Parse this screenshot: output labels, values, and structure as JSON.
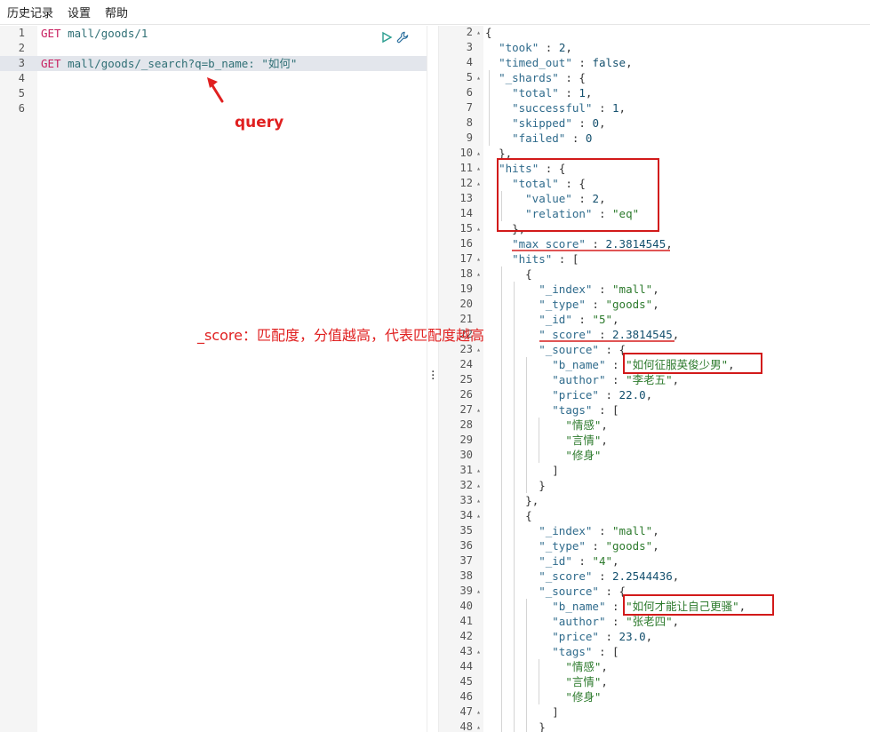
{
  "menu": [
    "历史记录",
    "设置",
    "帮助"
  ],
  "request": {
    "lines": [
      {
        "n": "1",
        "method": "GET",
        "url": " mall/goods/1"
      },
      {
        "n": "2",
        "method": "",
        "url": ""
      },
      {
        "n": "3",
        "method": "GET",
        "url": " mall/goods/_search?q=b_name: \"如何\""
      },
      {
        "n": "4",
        "method": "",
        "url": ""
      },
      {
        "n": "5",
        "method": "",
        "url": ""
      },
      {
        "n": "6",
        "method": "",
        "url": ""
      }
    ],
    "active_line": "3"
  },
  "annotations": {
    "query_label": "query",
    "score_note": "_score：匹配度，分值越高，代表匹配度越高"
  },
  "response": {
    "lines": [
      {
        "n": "2",
        "fold": true,
        "text": "{"
      },
      {
        "n": "3",
        "fold": false,
        "text": "  \"took\" : 2,"
      },
      {
        "n": "4",
        "fold": false,
        "text": "  \"timed_out\" : false,"
      },
      {
        "n": "5",
        "fold": true,
        "text": "  \"_shards\" : {"
      },
      {
        "n": "6",
        "fold": false,
        "text": "    \"total\" : 1,"
      },
      {
        "n": "7",
        "fold": false,
        "text": "    \"successful\" : 1,"
      },
      {
        "n": "8",
        "fold": false,
        "text": "    \"skipped\" : 0,"
      },
      {
        "n": "9",
        "fold": false,
        "text": "    \"failed\" : 0"
      },
      {
        "n": "10",
        "fold": true,
        "text": "  },"
      },
      {
        "n": "11",
        "fold": true,
        "text": "  \"hits\" : {"
      },
      {
        "n": "12",
        "fold": true,
        "text": "    \"total\" : {"
      },
      {
        "n": "13",
        "fold": false,
        "text": "      \"value\" : 2,"
      },
      {
        "n": "14",
        "fold": false,
        "text": "      \"relation\" : \"eq\""
      },
      {
        "n": "15",
        "fold": true,
        "text": "    },"
      },
      {
        "n": "16",
        "fold": false,
        "text": "    \"max_score\" : 2.3814545,"
      },
      {
        "n": "17",
        "fold": true,
        "text": "    \"hits\" : ["
      },
      {
        "n": "18",
        "fold": true,
        "text": "      {"
      },
      {
        "n": "19",
        "fold": false,
        "text": "        \"_index\" : \"mall\","
      },
      {
        "n": "20",
        "fold": false,
        "text": "        \"_type\" : \"goods\","
      },
      {
        "n": "21",
        "fold": false,
        "text": "        \"_id\" : \"5\","
      },
      {
        "n": "22",
        "fold": false,
        "text": "        \"_score\" : 2.3814545,"
      },
      {
        "n": "23",
        "fold": true,
        "text": "        \"_source\" : {"
      },
      {
        "n": "24",
        "fold": false,
        "text": "          \"b_name\" : \"如何征服英俊少男\","
      },
      {
        "n": "25",
        "fold": false,
        "text": "          \"author\" : \"李老五\","
      },
      {
        "n": "26",
        "fold": false,
        "text": "          \"price\" : 22.0,"
      },
      {
        "n": "27",
        "fold": true,
        "text": "          \"tags\" : ["
      },
      {
        "n": "28",
        "fold": false,
        "text": "            \"情感\","
      },
      {
        "n": "29",
        "fold": false,
        "text": "            \"言情\","
      },
      {
        "n": "30",
        "fold": false,
        "text": "            \"修身\""
      },
      {
        "n": "31",
        "fold": true,
        "text": "          ]"
      },
      {
        "n": "32",
        "fold": true,
        "text": "        }"
      },
      {
        "n": "33",
        "fold": true,
        "text": "      },"
      },
      {
        "n": "34",
        "fold": true,
        "text": "      {"
      },
      {
        "n": "35",
        "fold": false,
        "text": "        \"_index\" : \"mall\","
      },
      {
        "n": "36",
        "fold": false,
        "text": "        \"_type\" : \"goods\","
      },
      {
        "n": "37",
        "fold": false,
        "text": "        \"_id\" : \"4\","
      },
      {
        "n": "38",
        "fold": false,
        "text": "        \"_score\" : 2.2544436,"
      },
      {
        "n": "39",
        "fold": true,
        "text": "        \"_source\" : {"
      },
      {
        "n": "40",
        "fold": false,
        "text": "          \"b_name\" : \"如何才能让自己更骚\","
      },
      {
        "n": "41",
        "fold": false,
        "text": "          \"author\" : \"张老四\","
      },
      {
        "n": "42",
        "fold": false,
        "text": "          \"price\" : 23.0,"
      },
      {
        "n": "43",
        "fold": true,
        "text": "          \"tags\" : ["
      },
      {
        "n": "44",
        "fold": false,
        "text": "            \"情感\","
      },
      {
        "n": "45",
        "fold": false,
        "text": "            \"言情\","
      },
      {
        "n": "46",
        "fold": false,
        "text": "            \"修身\""
      },
      {
        "n": "47",
        "fold": true,
        "text": "          ]"
      },
      {
        "n": "48",
        "fold": true,
        "text": "        }"
      }
    ]
  }
}
